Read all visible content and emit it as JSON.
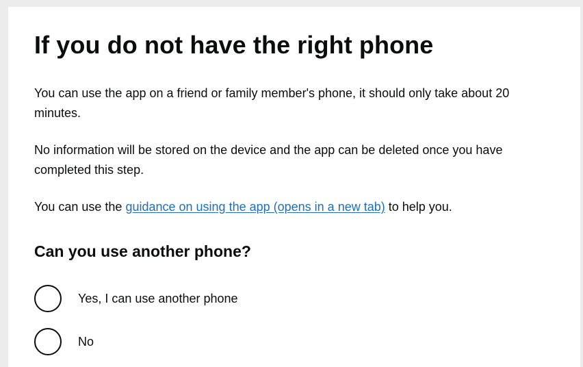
{
  "heading": "If you do not have the right phone",
  "paragraphs": {
    "p1": "You can use the app on a friend or family member's phone, it should only take about 20 minutes.",
    "p2": "No information will be stored on the device and the app can be deleted once you have completed this step.",
    "p3_before": "You can use the ",
    "p3_link": "guidance on using the app (opens in a new tab)",
    "p3_after": " to help you."
  },
  "question": "Can you use another phone?",
  "options": [
    {
      "label": "Yes, I can use another phone",
      "selected": false
    },
    {
      "label": "No",
      "selected": false
    }
  ],
  "colors": {
    "text": "#0b0c0c",
    "link": "#1d70b8",
    "background": "#ffffff",
    "frame": "#ececec"
  }
}
